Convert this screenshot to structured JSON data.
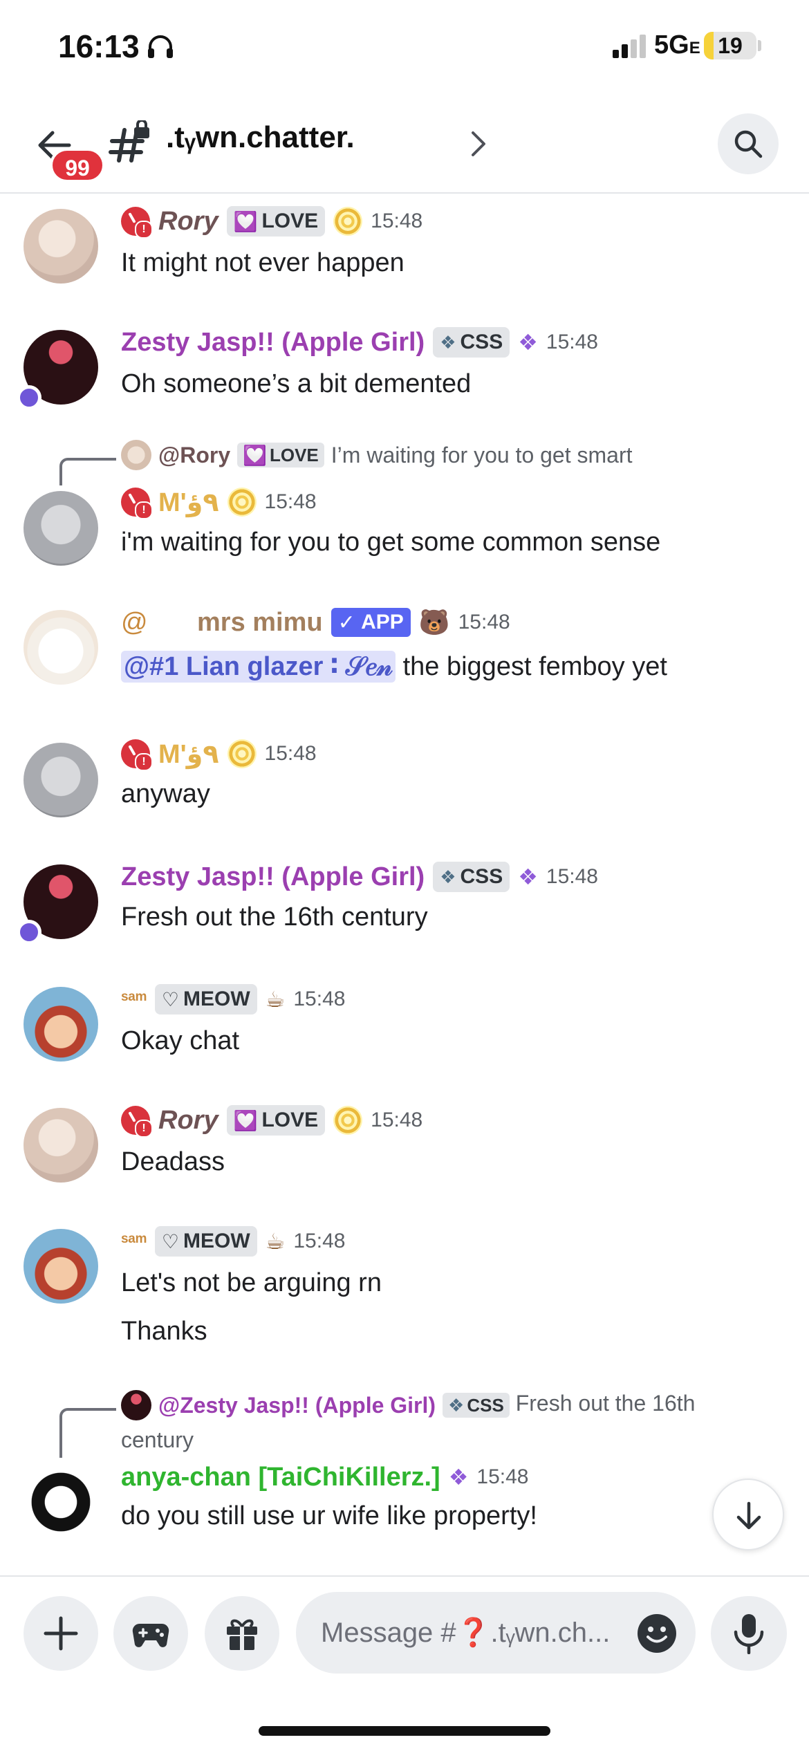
{
  "status_bar": {
    "time": "16:13",
    "network": "5G",
    "network_suffix": "E",
    "battery": "19",
    "battery_level": 0.19,
    "icons": [
      "headphones-icon",
      "signal-icon",
      "battery-icon"
    ]
  },
  "header": {
    "unread_badge": "99",
    "channel_name": ".tᵧwn.chatter.",
    "icons": [
      "back-arrow-icon",
      "hash-lock-icon",
      "chevron-right-icon",
      "search-icon"
    ]
  },
  "messages": [
    {
      "author": "Rory",
      "author_color": "#6d5254",
      "tag": "LOVE",
      "tag_icon": "heart-icon",
      "time": "15:48",
      "lines": [
        "It might not ever happen"
      ]
    },
    {
      "author": "Zesty Jasp!! (Apple Girl)",
      "author_color": "#9b3fb0",
      "tag": "CSS",
      "tag_icon": "diamond-icon",
      "time": "15:48",
      "lines": [
        "Oh someone’s a bit demented"
      ]
    },
    {
      "reply": {
        "author": "@Rory",
        "tag": "LOVE",
        "text": "I’m waiting for you to get smart"
      },
      "author": "M'٩ؤ",
      "author_color": "#e3b24c",
      "time": "15:48",
      "lines": [
        "i'm waiting for you to get some common sense"
      ]
    },
    {
      "author_prefix": "@",
      "author": "mrs mimu",
      "author_color": "#a37f5d",
      "app_tag": "APP",
      "time": "15:48",
      "mention": "@#1 Lian glazer ∶ 𝒮𝑒𝓃",
      "lines": [
        "the biggest femboy yet"
      ]
    },
    {
      "author": "M'٩ؤ",
      "author_color": "#e3b24c",
      "time": "15:48",
      "lines": [
        "anyway"
      ]
    },
    {
      "author": "Zesty Jasp!! (Apple Girl)",
      "author_color": "#9b3fb0",
      "tag": "CSS",
      "tag_icon": "diamond-icon",
      "time": "15:48",
      "lines": [
        "Fresh out the 16th century"
      ]
    },
    {
      "author": "ˢᵃᵐ",
      "author_color": "#c98a3d",
      "tag": "MEOW",
      "tag_icon": "heart-outline-icon",
      "time": "15:48",
      "lines": [
        "Okay chat"
      ]
    },
    {
      "author": "Rory",
      "author_color": "#6d5254",
      "tag": "LOVE",
      "tag_icon": "heart-icon",
      "time": "15:48",
      "lines": [
        "Deadass"
      ]
    },
    {
      "author": "ˢᵃᵐ",
      "author_color": "#c98a3d",
      "tag": "MEOW",
      "tag_icon": "heart-outline-icon",
      "time": "15:48",
      "lines": [
        "Let's not be arguing rn",
        "Thanks"
      ]
    },
    {
      "reply": {
        "author": "@Zesty Jasp!! (Apple Girl)",
        "tag": "CSS",
        "text": "Fresh out the 16th century"
      },
      "author": "anya-chan [TaiChiKillerz.]",
      "author_color": "#2fb52f",
      "time": "15:48",
      "lines": [
        "do you still use ur wife like property!"
      ]
    }
  ],
  "composer": {
    "placeholder": "Message #❓.tᵧwn.ch...",
    "icons": [
      "plus-icon",
      "gamepad-icon",
      "gift-icon",
      "emoji-icon",
      "microphone-icon"
    ]
  },
  "jump_button_icon": "arrow-down-icon",
  "colors": {
    "accent": "#5865f2",
    "danger": "#e0323c",
    "mention_bg": "#dfe1fb"
  }
}
